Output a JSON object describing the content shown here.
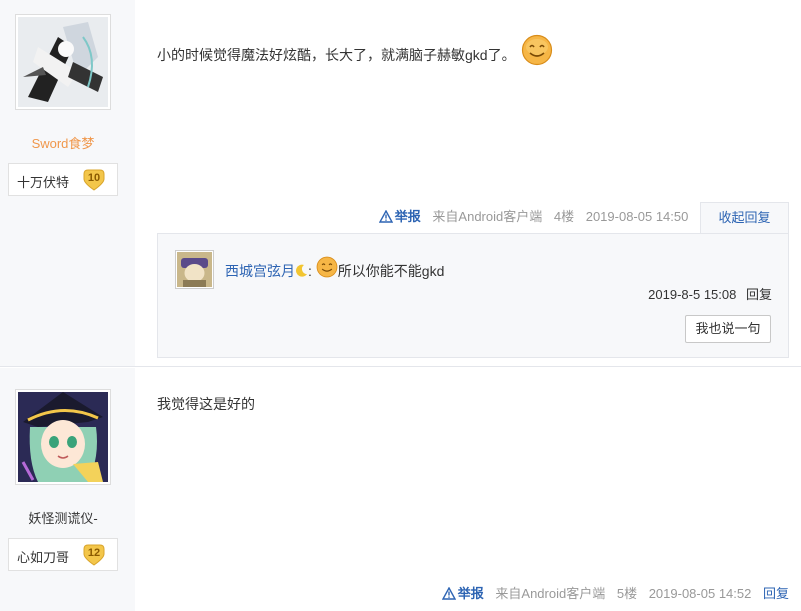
{
  "posts": [
    {
      "username": "Sword食梦",
      "level_name": "十万伏特",
      "level": "10",
      "content": "小的时候觉得魔法好炫酷，长大了，就满脑子赫敏gkd了。",
      "tail": {
        "report": "举报",
        "source": "来自Android客户端",
        "floor": "4楼",
        "time": "2019-08-05 14:50",
        "reply_action": "收起回复"
      },
      "replies": [
        {
          "username": "西城宫弦月",
          "text": "所以你能不能gkd",
          "time": "2019-8-5 15:08",
          "reply_label": "回复"
        }
      ],
      "say_button": "我也说一句"
    },
    {
      "username": "妖怪测谎仪-",
      "level_name": "心如刀哥",
      "level": "12",
      "content": "我觉得这是好的",
      "tail": {
        "report": "举报",
        "source": "来自Android客户端",
        "floor": "5楼",
        "time": "2019-08-05 14:52",
        "reply_action": "回复"
      }
    }
  ],
  "colors": {
    "link": "#2d64b3",
    "username_orange": "#f0974b",
    "sidebar_bg": "#f7f8fa",
    "badge_gold": "#f3c64a"
  }
}
